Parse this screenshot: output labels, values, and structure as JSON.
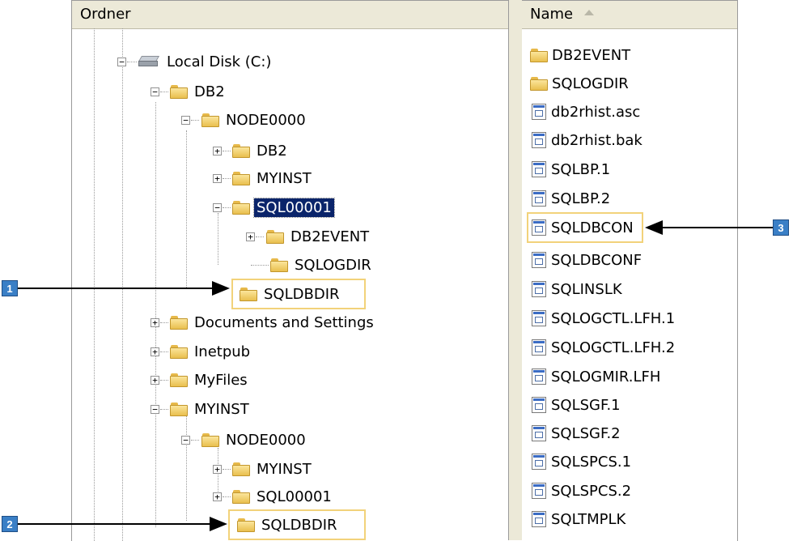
{
  "folder_pane": {
    "header": "Ordner",
    "tree": [
      {
        "label": "Local Disk (C:)",
        "icon": "drive-icon",
        "expander": "−"
      },
      {
        "label": "DB2",
        "icon": "folder-icon",
        "expander": "−"
      },
      {
        "label": "NODE0000",
        "icon": "folder-icon",
        "expander": "−"
      },
      {
        "label": "DB2",
        "icon": "folder-icon",
        "expander": "+"
      },
      {
        "label": "MYINST",
        "icon": "folder-icon",
        "expander": "+"
      },
      {
        "label": "SQL00001",
        "icon": "folder-icon",
        "expander": "−",
        "selected": true
      },
      {
        "label": "DB2EVENT",
        "icon": "folder-icon",
        "expander": "+"
      },
      {
        "label": "SQLOGDIR",
        "icon": "folder-icon",
        "expander": ""
      },
      {
        "label": "SQLDBDIR",
        "icon": "folder-icon",
        "expander": "",
        "highlighted": true
      },
      {
        "label": "Documents and Settings",
        "icon": "folder-icon",
        "expander": "+"
      },
      {
        "label": "Inetpub",
        "icon": "folder-icon",
        "expander": "+"
      },
      {
        "label": "MyFiles",
        "icon": "folder-icon",
        "expander": "+"
      },
      {
        "label": "MYINST",
        "icon": "folder-icon",
        "expander": "−"
      },
      {
        "label": "NODE0000",
        "icon": "folder-icon",
        "expander": "−"
      },
      {
        "label": "MYINST",
        "icon": "folder-icon",
        "expander": "+"
      },
      {
        "label": "SQL00001",
        "icon": "folder-icon",
        "expander": "+"
      },
      {
        "label": "SQLDBDIR",
        "icon": "folder-icon",
        "expander": "",
        "highlighted": true
      }
    ]
  },
  "file_pane": {
    "header": "Name",
    "files": [
      {
        "name": "DB2EVENT",
        "icon": "folder-icon"
      },
      {
        "name": "SQLOGDIR",
        "icon": "folder-icon"
      },
      {
        "name": "db2rhist.asc",
        "icon": "file-icon"
      },
      {
        "name": "db2rhist.bak",
        "icon": "file-icon"
      },
      {
        "name": "SQLBP.1",
        "icon": "file-icon"
      },
      {
        "name": "SQLBP.2",
        "icon": "file-icon"
      },
      {
        "name": "SQLDBCON",
        "icon": "file-icon",
        "highlighted": true
      },
      {
        "name": "SQLDBCONF",
        "icon": "file-icon"
      },
      {
        "name": "SQLINSLK",
        "icon": "file-icon"
      },
      {
        "name": "SQLOGCTL.LFH.1",
        "icon": "file-icon"
      },
      {
        "name": "SQLOGCTL.LFH.2",
        "icon": "file-icon"
      },
      {
        "name": "SQLOGMIR.LFH",
        "icon": "file-icon"
      },
      {
        "name": "SQLSGF.1",
        "icon": "file-icon"
      },
      {
        "name": "SQLSGF.2",
        "icon": "file-icon"
      },
      {
        "name": "SQLSPCS.1",
        "icon": "file-icon"
      },
      {
        "name": "SQLSPCS.2",
        "icon": "file-icon"
      },
      {
        "name": "SQLTMPLK",
        "icon": "file-icon"
      }
    ]
  },
  "callouts": {
    "one": "1",
    "two": "2",
    "three": "3"
  },
  "colors": {
    "highlight_box": "#f2d27a",
    "callout_fill": "#3a7fc6",
    "selection": "#0a246a"
  }
}
